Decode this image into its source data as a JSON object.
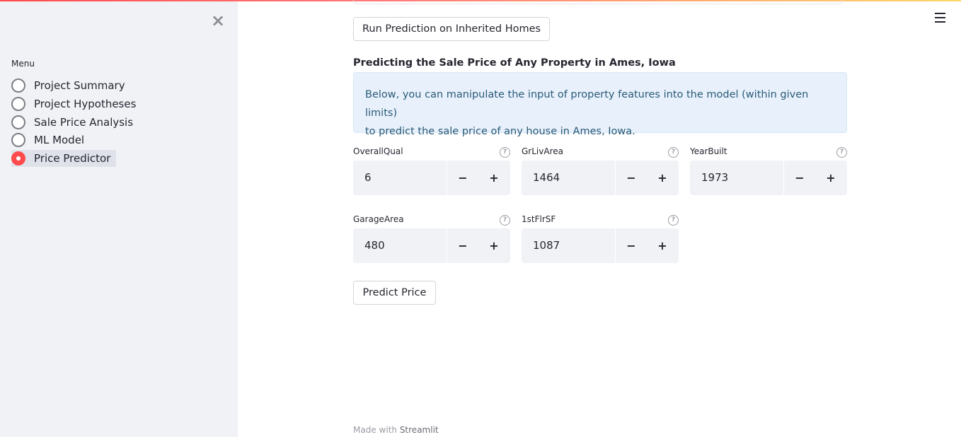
{
  "sidebar": {
    "close_icon": "close-icon",
    "menu_label": "Menu",
    "items": [
      {
        "label": "Project Summary",
        "selected": false
      },
      {
        "label": "Project Hypotheses",
        "selected": false
      },
      {
        "label": "Sale Price Analysis",
        "selected": false
      },
      {
        "label": "ML Model",
        "selected": false
      },
      {
        "label": "Price Predictor",
        "selected": true
      }
    ]
  },
  "header": {
    "menu_icon": "hamburger-icon"
  },
  "main": {
    "run_button_label": "Run Prediction on Inherited Homes",
    "section_title": "Predicting the Sale Price of Any Property in Ames, Iowa",
    "info_text_line1": "Below, you can manipulate the input of property features into the model (within given limits)",
    "info_text_line2": "to predict the sale price of any house in Ames, Iowa.",
    "fields": [
      {
        "label": "OverallQual",
        "value": "6"
      },
      {
        "label": "GrLivArea",
        "value": "1464"
      },
      {
        "label": "YearBuilt",
        "value": "1973"
      },
      {
        "label": "GarageArea",
        "value": "480"
      },
      {
        "label": "1stFlrSF",
        "value": "1087"
      }
    ],
    "minus_label": "−",
    "plus_label": "+",
    "help_label": "?",
    "predict_button_label": "Predict Price"
  },
  "footer": {
    "made_with": "Made with",
    "brand": "Streamlit"
  },
  "colors": {
    "accent": "#ff4b4b",
    "sidebar_bg": "#f0f2f6",
    "info_bg": "#e8f1fb"
  }
}
